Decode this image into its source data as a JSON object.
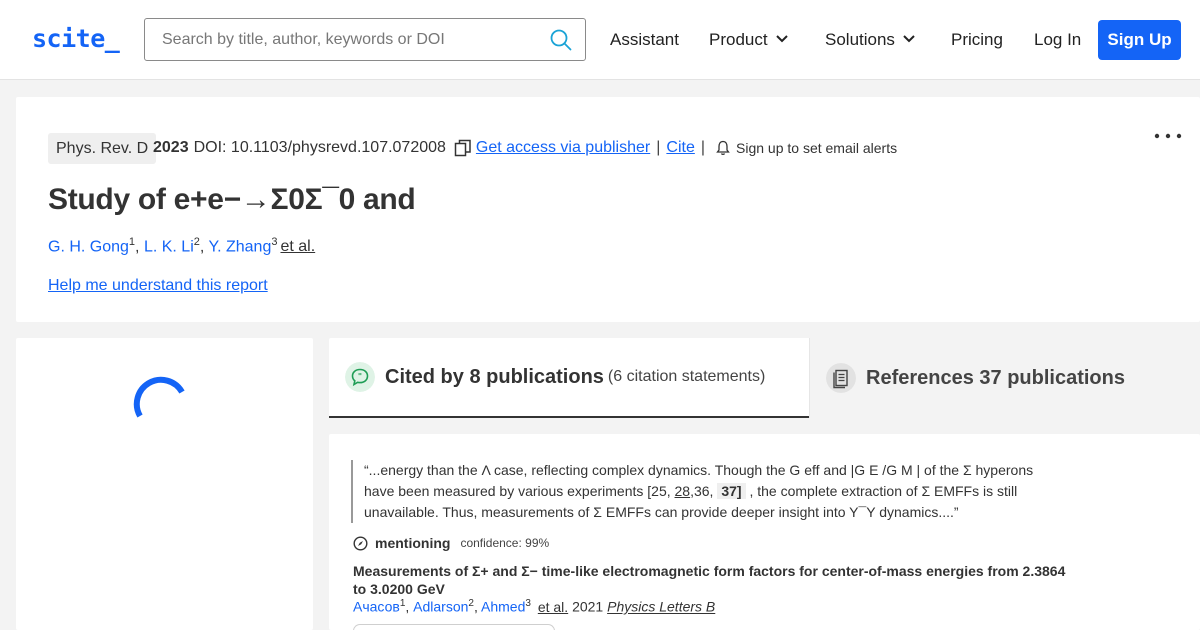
{
  "header": {
    "logo": "scite_",
    "search_placeholder": "Search by title, author, keywords or DOI",
    "nav": {
      "assistant": "Assistant",
      "product": "Product",
      "solutions": "Solutions",
      "pricing": "Pricing",
      "login": "Log In",
      "signup": "Sign Up"
    },
    "accent_color": "#1464f6"
  },
  "report": {
    "journal": "Phys. Rev. D",
    "year": "2023",
    "doi": "DOI: 10.1103/physrevd.107.072008",
    "access_link": "Get access via publisher",
    "cite_link": "Cite",
    "alerts_text": "Sign up to set email alerts",
    "title": "Study of e+e−→Σ0Σ¯0 and",
    "authors": [
      {
        "name": "G. H. Gong",
        "sup": "1"
      },
      {
        "name": "L. K. Li",
        "sup": "2"
      },
      {
        "name": "Y. Zhang",
        "sup": "3"
      }
    ],
    "et_al": "et al.",
    "help_link": "Help me understand this report"
  },
  "tabs": {
    "cited": {
      "label": "Cited by 8 publications",
      "sub": "(6 citation statements)"
    },
    "references": {
      "label": "References 37 publications"
    }
  },
  "citation": {
    "snippet_pre": "“...energy than the Λ case, reflecting complex dynamics. Though the G eff and |G E /G M | of the Σ hyperons have been measured by various experiments [25, ",
    "ref1": "28",
    "snippet_mid": ",36, ",
    "ref2": "37]",
    "snippet_post": " , the complete extraction of Σ EMFFs is still unavailable. Thus, measurements of Σ EMFFs can provide deeper insight into Y¯Y dynamics....”",
    "type": "mentioning",
    "confidence": "confidence: 99%",
    "title": "Measurements of Σ+ and Σ− time-like electromagnetic form factors for center-of-mass energies from 2.3864 to 3.0200 GeV",
    "authors": [
      {
        "name": "Ачасов",
        "sup": "1"
      },
      {
        "name": "Adlarson",
        "sup": "2"
      },
      {
        "name": "Ahmed",
        "sup": "3"
      }
    ],
    "et_al": "et al.",
    "year": "2021",
    "journal": "Physics Letters B"
  }
}
